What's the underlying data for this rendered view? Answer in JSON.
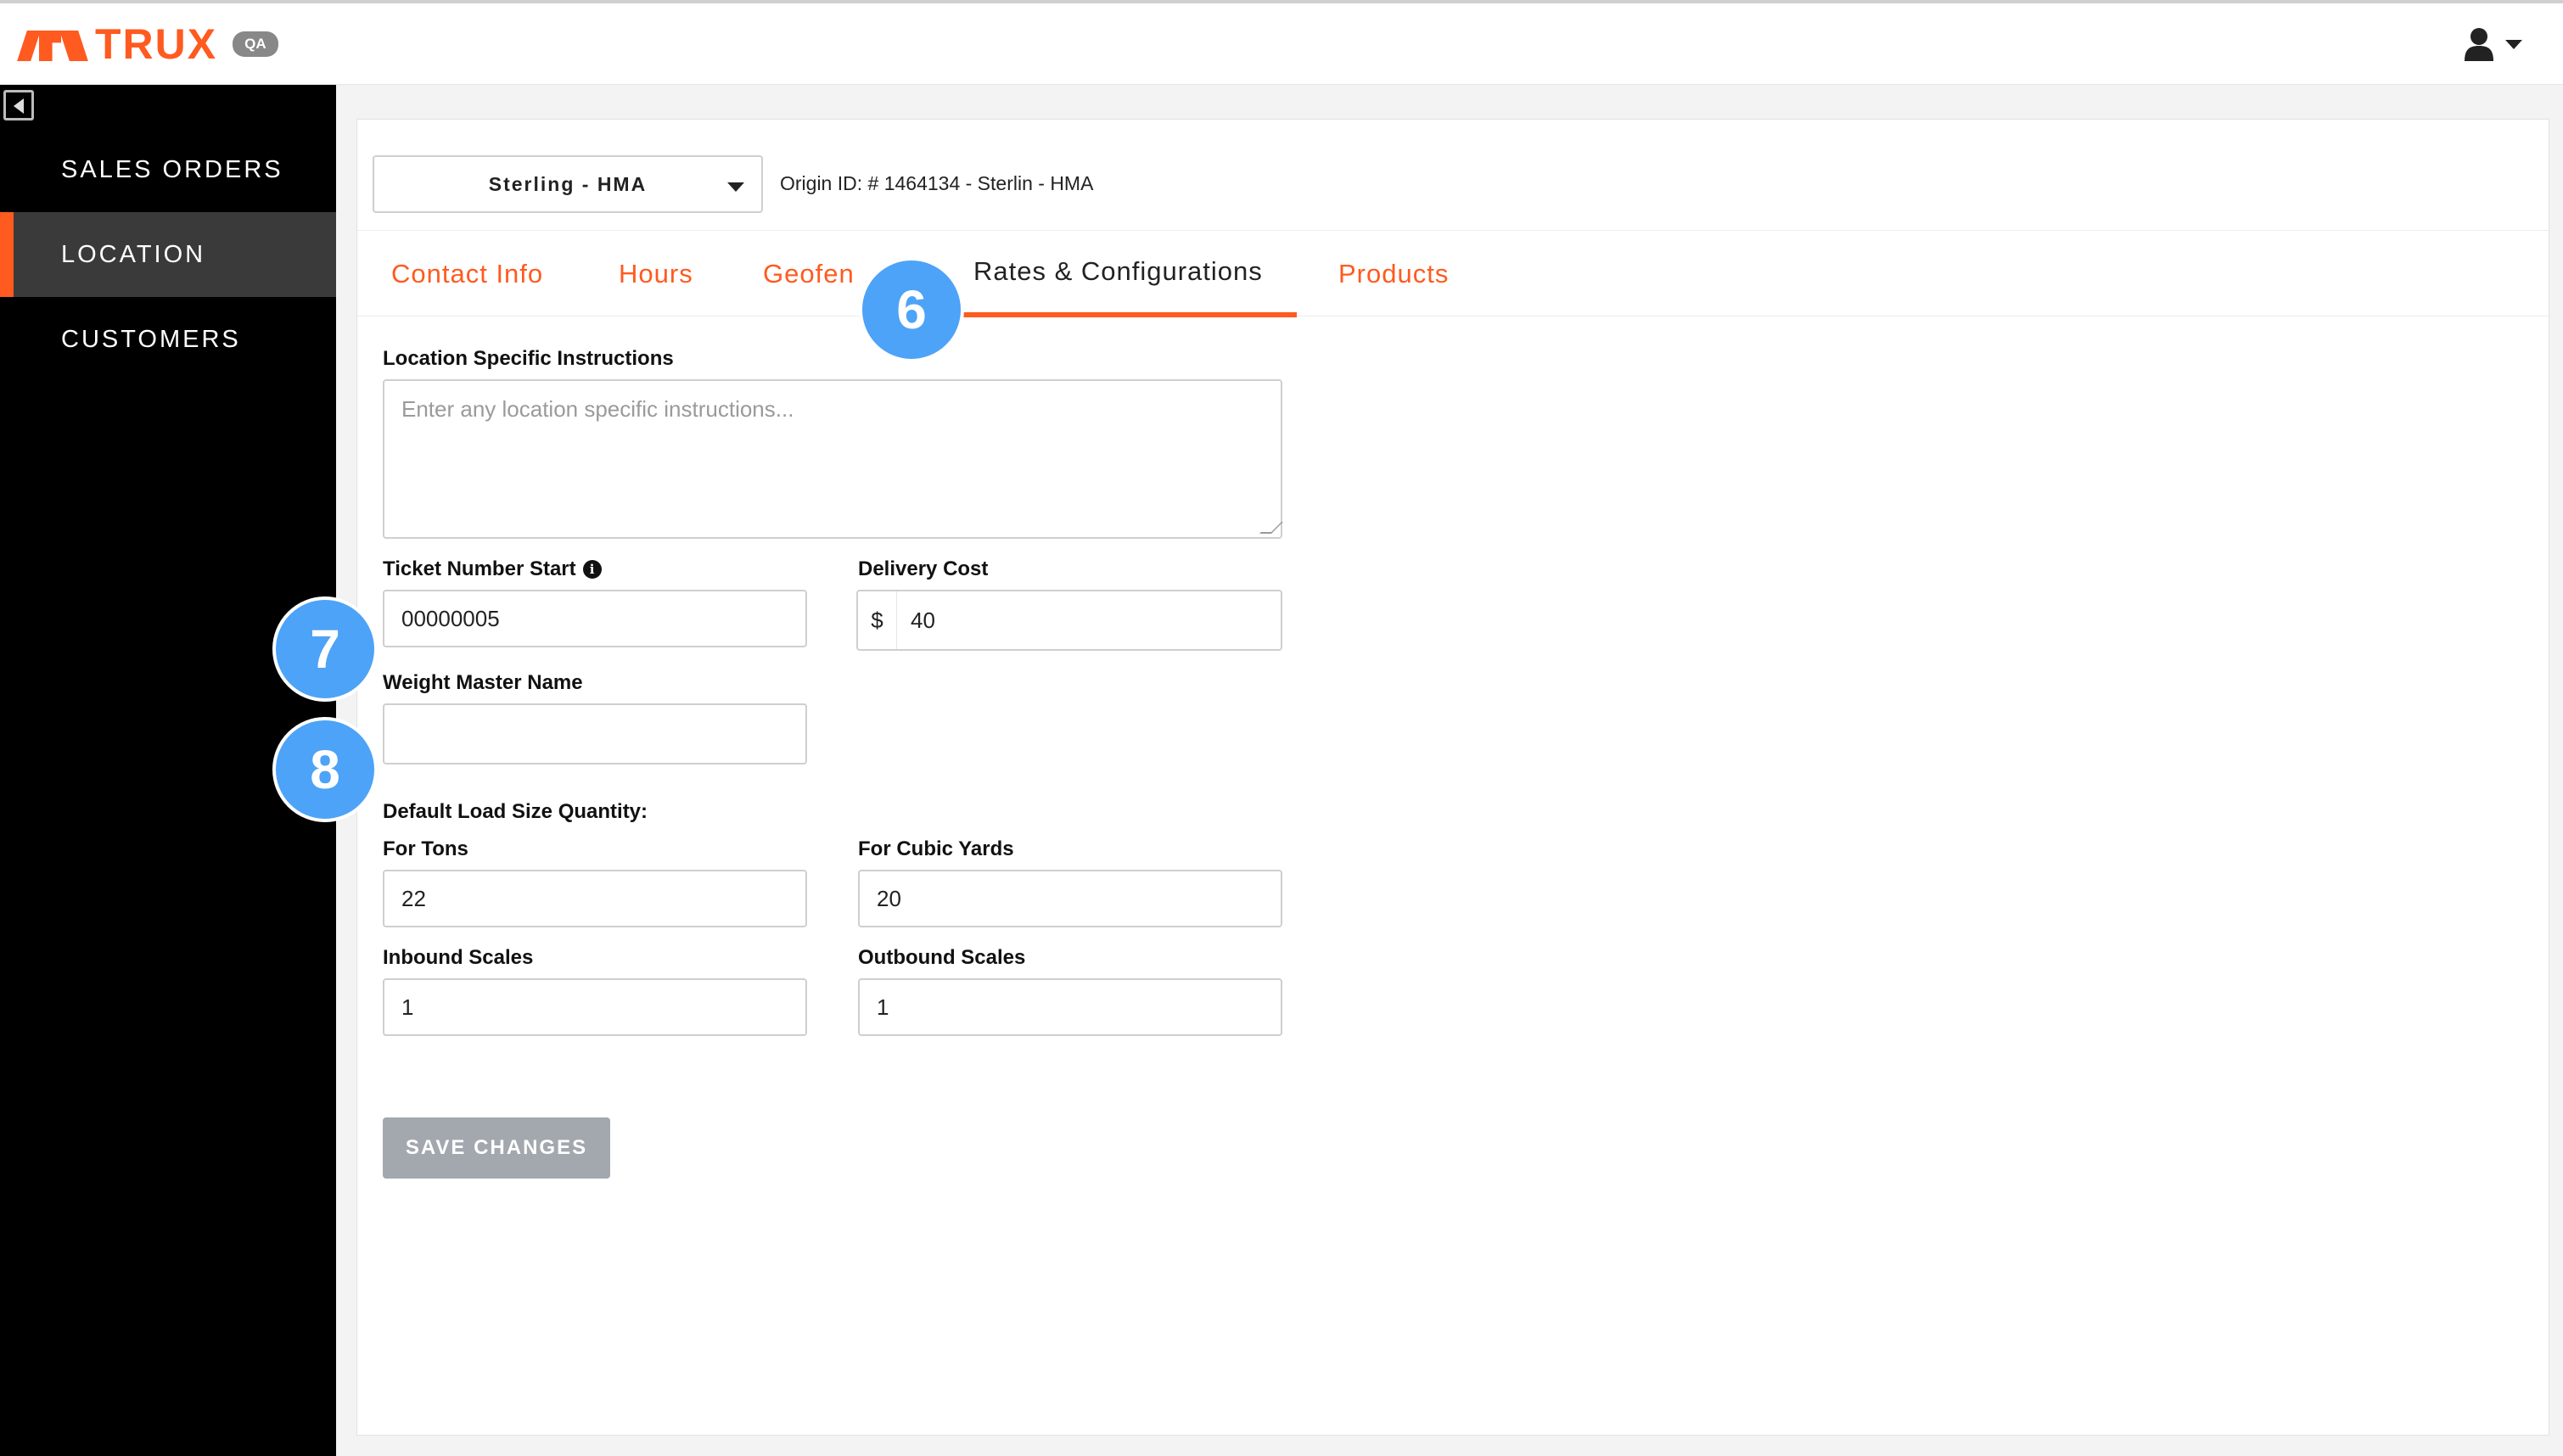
{
  "header": {
    "logo_text": "TRUX",
    "env_badge": "QA",
    "user_icon": "user-icon",
    "dropdown_icon": "caret-down-icon"
  },
  "sidebar": {
    "collapse_icon": "collapse-left-icon",
    "items": [
      {
        "label": "SALES ORDERS",
        "active": false
      },
      {
        "label": "LOCATION",
        "active": true
      },
      {
        "label": "CUSTOMERS",
        "active": false
      }
    ]
  },
  "location_bar": {
    "selected_location": "Sterling - HMA",
    "origin_id": "Origin ID: # 1464134 - Sterlin - HMA"
  },
  "tabs": [
    {
      "label": "Contact Info",
      "active": false
    },
    {
      "label": "Hours",
      "active": false
    },
    {
      "label": "Geofen",
      "active": false
    },
    {
      "label": "Rates & Configurations",
      "active": true
    },
    {
      "label": "Products",
      "active": false
    }
  ],
  "step_badges": {
    "six": "6",
    "seven": "7",
    "eight": "8"
  },
  "form": {
    "instructions_label": "Location Specific Instructions",
    "instructions_placeholder": "Enter any location specific instructions...",
    "ticket_start_label": "Ticket Number Start",
    "ticket_start_value": "00000005",
    "ticket_info_icon": "info-icon",
    "delivery_cost_label": "Delivery Cost",
    "delivery_cost_prefix": "$",
    "delivery_cost_value": "40",
    "weight_master_label": "Weight Master Name",
    "weight_master_value": "",
    "default_load_label": "Default Load Size Quantity:",
    "tons_label": "For Tons",
    "tons_value": "22",
    "cubic_yards_label": "For Cubic Yards",
    "cubic_yards_value": "20",
    "inbound_label": "Inbound Scales",
    "inbound_value": "1",
    "outbound_label": "Outbound Scales",
    "outbound_value": "1",
    "save_label": "SAVE CHANGES"
  },
  "colors": {
    "brand_orange": "#ff5a1f",
    "sidebar_bg": "#000000",
    "active_nav_bg": "#3a3a3a",
    "step_badge_blue": "#4da3f7",
    "save_disabled": "#a3a8ae"
  }
}
